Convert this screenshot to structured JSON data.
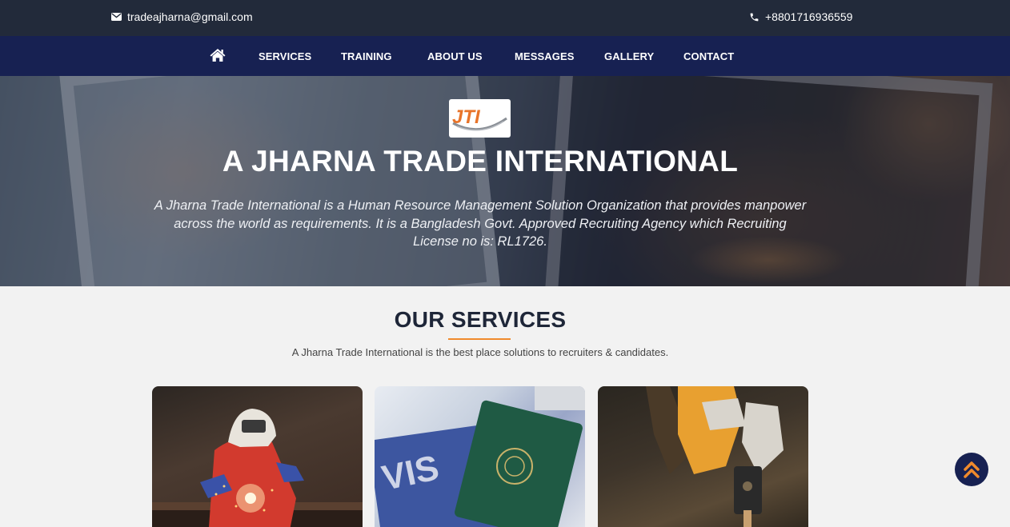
{
  "topbar": {
    "email": "tradeajharna@gmail.com",
    "phone": "+8801716936559",
    "email_icon": "envelope-icon",
    "phone_icon": "phone-icon"
  },
  "nav": {
    "home_icon": "home-icon",
    "items": [
      "SERVICES",
      "TRAINING",
      "ABOUT US",
      "MESSAGES",
      "GALLERY",
      "CONTACT"
    ]
  },
  "hero": {
    "logo_text": "JTI",
    "title": "A JHARNA TRADE INTERNATIONAL",
    "description": "A Jharna Trade International is a Human Resource Management Solution Organization that provides manpower across the world as requirements. It is a Bangladesh Govt. Approved Recruiting Agency which Recruiting License no is: RL1726."
  },
  "services": {
    "title": "OUR SERVICES",
    "subtitle": "A Jharna Trade International is the best place solutions to recruiters & candidates.",
    "cards": [
      {
        "image": "welder-photo"
      },
      {
        "image": "visa-passport-photo"
      },
      {
        "image": "gloved-hand-drill-photo"
      }
    ]
  },
  "scroll_top_icon": "double-chevron-up-icon",
  "colors": {
    "topbar_bg": "#222a3a",
    "nav_bg": "#172152",
    "accent": "#f08a2c",
    "heading": "#1e2638",
    "page_bg": "#f2f2f2"
  }
}
